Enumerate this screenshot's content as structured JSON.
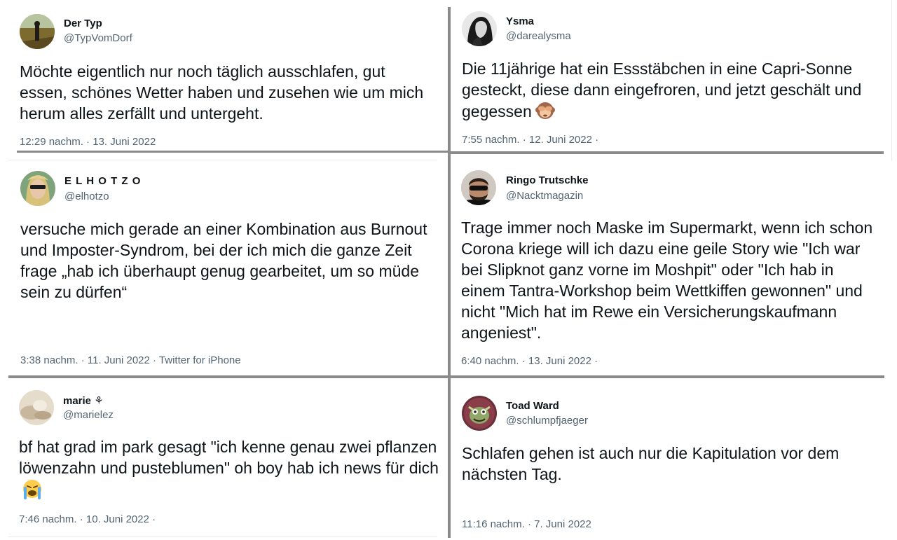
{
  "tweets": [
    {
      "name": "Der Typ",
      "handle": "@TypVomDorf",
      "text": "Möchte eigentlich nur noch täglich ausschlafen, gut essen, schönes Wetter haben und zusehen wie um mich herum alles zerfällt und untergeht.",
      "meta": "12:29 nachm. · 13. Juni 2022",
      "avatar_icon": "person-in-field-avatar"
    },
    {
      "name": "Ysma",
      "handle": "@darealysma",
      "text": "Die 11jährige hat ein Essstäbchen in eine Capri-Sonne gesteckt, diese dann eingefroren, und jetzt geschält und gegessen",
      "emoji": "see-no-evil-monkey-emoji",
      "meta": "7:55 nachm. · 12. Juni 2022 ·",
      "avatar_icon": "black-white-portrait-avatar"
    },
    {
      "name": "E L H O T Z O",
      "handle": "@elhotzo",
      "text": "versuche mich gerade an einer Kombination aus Burnout und Imposter-Syndrom, bei der ich mich die ganze Zeit frage „hab ich überhaupt genug gearbeitet, um so müde sein zu dürfen“",
      "meta": "3:38 nachm. · 11. Juni 2022 · Twitter for iPhone",
      "avatar_icon": "blond-man-sunglasses-avatar"
    },
    {
      "name": "Ringo Trutschke",
      "handle": "@Nacktmagazin",
      "text": "Trage immer noch Maske im Supermarkt, wenn ich schon Corona kriege will ich dazu eine geile Story wie \"Ich war bei Slipknot ganz vorne im Moshpit\" oder \"Ich hab in einem Tantra-Workshop beim Wettkiffen gewonnen\" und nicht \"Mich hat im Rewe ein Versicherungskaufmann angeniest\".",
      "meta": "6:40 nachm. · 13. Juni 2022 ·",
      "avatar_icon": "bearded-man-sunglasses-avatar"
    },
    {
      "name": "marie ⚘",
      "handle": "@marielez",
      "text": "bf hat grad im park gesagt \"ich kenne genau zwei pflanzen löwenzahn und pusteblumen\" oh boy hab ich news für dich",
      "emoji": "loudly-crying-face-emoji",
      "meta": "7:46 nachm. · 10. Juni 2022 ·",
      "avatar_icon": "beige-blurred-photo-avatar"
    },
    {
      "name": "Toad Ward",
      "handle": "@schlumpfjaeger",
      "text": "Schlafen gehen ist auch nur die Kapitulation vor dem nächsten Tag.",
      "meta": "11:16 nachm. · 7. Juni 2022",
      "avatar_icon": "cartoon-creature-avatar"
    }
  ],
  "colors": {
    "text": "#0f1419",
    "secondary": "#536471",
    "divider": "#8a8a8a"
  }
}
